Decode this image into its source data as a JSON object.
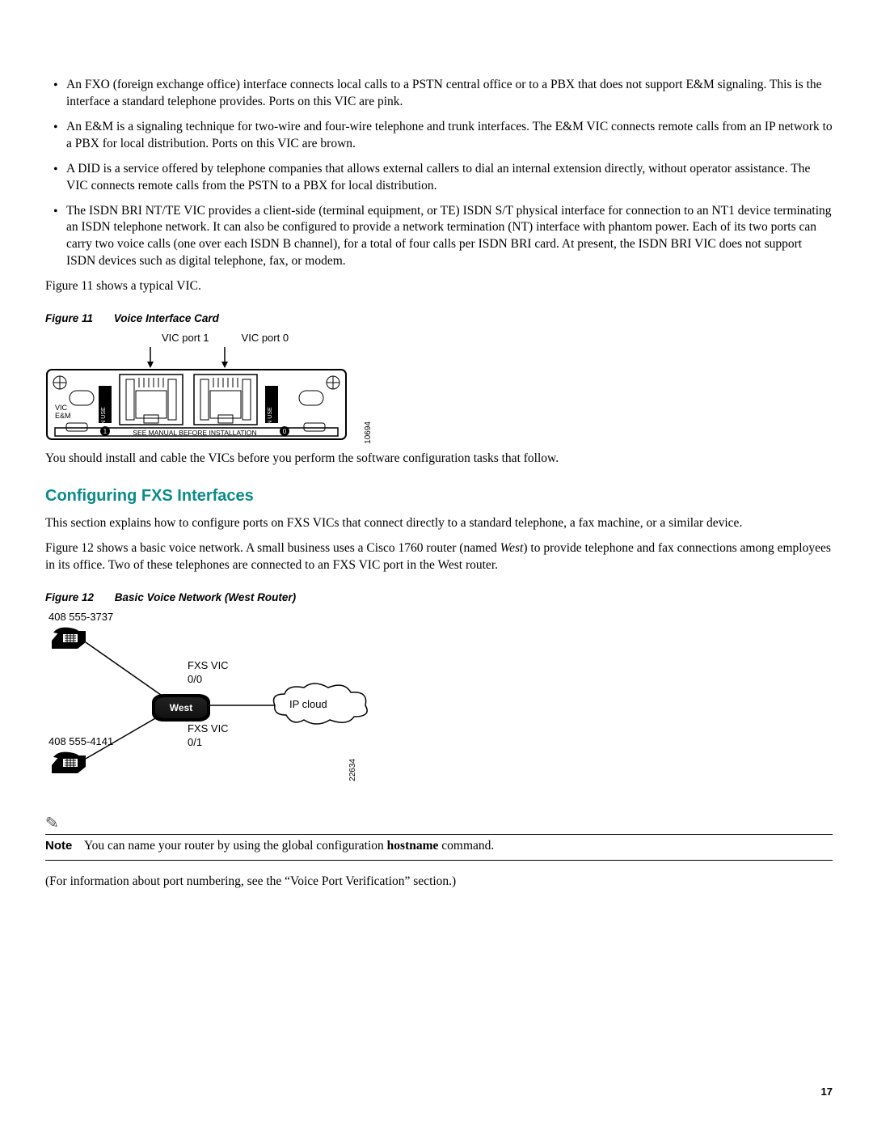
{
  "bullets": [
    "An FXO (foreign exchange office) interface connects local calls to a PSTN central office or to a PBX that does not support E&M signaling. This is the interface a standard telephone provides. Ports on this VIC are pink.",
    "An E&M is a signaling technique for two-wire and four-wire telephone and trunk interfaces. The E&M VIC connects remote calls from an IP network to a PBX for local distribution. Ports on this VIC are brown.",
    "A DID is a service offered by telephone companies that allows external callers to dial an internal extension directly, without operator assistance. The VIC connects remote calls from the PSTN to a PBX for local distribution.",
    "The ISDN BRI NT/TE VIC provides a client-side (terminal equipment, or TE) ISDN S/T physical interface for connection to an NT1 device terminating an ISDN telephone network. It can also be configured to provide a network termination (NT) interface with phantom power. Each of its two ports can carry two voice calls (one over each ISDN B channel), for a total of four calls per ISDN BRI card. At present, the ISDN BRI VIC does not support ISDN devices such as digital telephone, fax, or modem."
  ],
  "para_fig_ref": "Figure 11 shows a typical VIC.",
  "figure11": {
    "caption_num": "Figure 11",
    "caption_title": "Voice Interface Card",
    "port1_label": "VIC port 1",
    "port0_label": "VIC port 0",
    "card_label_top": "VIC",
    "card_label_bottom": "E&M",
    "inuse_label": "IN USE",
    "manual_text": "SEE MANUAL BEFORE INSTALLATION",
    "drawing_id": "10694"
  },
  "para_install": "You should install and cable the VICs before you perform the software configuration tasks that follow.",
  "section_title": "Configuring FXS Interfaces",
  "para_section_intro": "This section explains how to configure ports on FXS VICs that connect directly to a standard telephone, a fax machine, or a similar device.",
  "figure12_ref_pre": "Figure 12 shows a basic voice network. A small business uses a Cisco 1760 router (named ",
  "figure12_ref_em": "West",
  "figure12_ref_post": ") to provide telephone and fax connections among employees in its office. Two of these telephones are connected to an FXS VIC port in the West router.",
  "figure12": {
    "caption_num": "Figure 12",
    "caption_title": "Basic Voice Network (West Router)",
    "phone1_number": "408 555-3737",
    "phone2_number": "408 555-4141",
    "fxs00_label": "FXS VIC\n0/0",
    "fxs01_label": "FXS VIC\n0/1",
    "router_label": "West",
    "cloud_label": "IP cloud",
    "drawing_id": "22634"
  },
  "note": {
    "label": "Note",
    "text_pre": "You can name your router by using the global configuration ",
    "text_bold": "hostname",
    "text_post": " command."
  },
  "para_port_numbering": "(For information about port numbering, see the “Voice Port Verification” section.)",
  "page_number": "17"
}
